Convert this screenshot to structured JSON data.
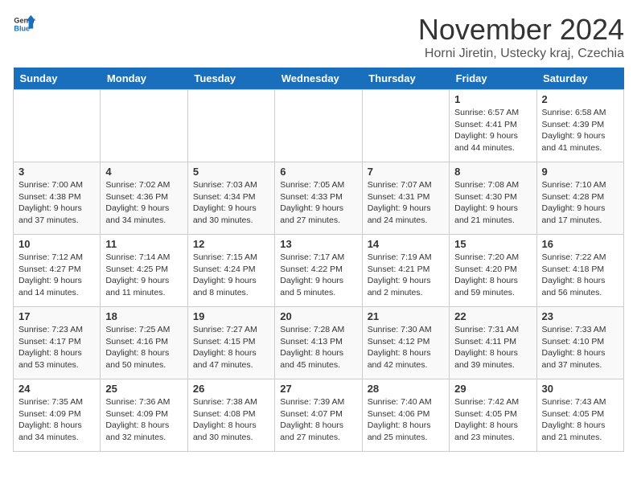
{
  "header": {
    "logo_general": "General",
    "logo_blue": "Blue",
    "title": "November 2024",
    "subtitle": "Horni Jiretin, Ustecky kraj, Czechia"
  },
  "weekdays": [
    "Sunday",
    "Monday",
    "Tuesday",
    "Wednesday",
    "Thursday",
    "Friday",
    "Saturday"
  ],
  "weeks": [
    [
      {
        "day": "",
        "info": ""
      },
      {
        "day": "",
        "info": ""
      },
      {
        "day": "",
        "info": ""
      },
      {
        "day": "",
        "info": ""
      },
      {
        "day": "",
        "info": ""
      },
      {
        "day": "1",
        "info": "Sunrise: 6:57 AM\nSunset: 4:41 PM\nDaylight: 9 hours and 44 minutes."
      },
      {
        "day": "2",
        "info": "Sunrise: 6:58 AM\nSunset: 4:39 PM\nDaylight: 9 hours and 41 minutes."
      }
    ],
    [
      {
        "day": "3",
        "info": "Sunrise: 7:00 AM\nSunset: 4:38 PM\nDaylight: 9 hours and 37 minutes."
      },
      {
        "day": "4",
        "info": "Sunrise: 7:02 AM\nSunset: 4:36 PM\nDaylight: 9 hours and 34 minutes."
      },
      {
        "day": "5",
        "info": "Sunrise: 7:03 AM\nSunset: 4:34 PM\nDaylight: 9 hours and 30 minutes."
      },
      {
        "day": "6",
        "info": "Sunrise: 7:05 AM\nSunset: 4:33 PM\nDaylight: 9 hours and 27 minutes."
      },
      {
        "day": "7",
        "info": "Sunrise: 7:07 AM\nSunset: 4:31 PM\nDaylight: 9 hours and 24 minutes."
      },
      {
        "day": "8",
        "info": "Sunrise: 7:08 AM\nSunset: 4:30 PM\nDaylight: 9 hours and 21 minutes."
      },
      {
        "day": "9",
        "info": "Sunrise: 7:10 AM\nSunset: 4:28 PM\nDaylight: 9 hours and 17 minutes."
      }
    ],
    [
      {
        "day": "10",
        "info": "Sunrise: 7:12 AM\nSunset: 4:27 PM\nDaylight: 9 hours and 14 minutes."
      },
      {
        "day": "11",
        "info": "Sunrise: 7:14 AM\nSunset: 4:25 PM\nDaylight: 9 hours and 11 minutes."
      },
      {
        "day": "12",
        "info": "Sunrise: 7:15 AM\nSunset: 4:24 PM\nDaylight: 9 hours and 8 minutes."
      },
      {
        "day": "13",
        "info": "Sunrise: 7:17 AM\nSunset: 4:22 PM\nDaylight: 9 hours and 5 minutes."
      },
      {
        "day": "14",
        "info": "Sunrise: 7:19 AM\nSunset: 4:21 PM\nDaylight: 9 hours and 2 minutes."
      },
      {
        "day": "15",
        "info": "Sunrise: 7:20 AM\nSunset: 4:20 PM\nDaylight: 8 hours and 59 minutes."
      },
      {
        "day": "16",
        "info": "Sunrise: 7:22 AM\nSunset: 4:18 PM\nDaylight: 8 hours and 56 minutes."
      }
    ],
    [
      {
        "day": "17",
        "info": "Sunrise: 7:23 AM\nSunset: 4:17 PM\nDaylight: 8 hours and 53 minutes."
      },
      {
        "day": "18",
        "info": "Sunrise: 7:25 AM\nSunset: 4:16 PM\nDaylight: 8 hours and 50 minutes."
      },
      {
        "day": "19",
        "info": "Sunrise: 7:27 AM\nSunset: 4:15 PM\nDaylight: 8 hours and 47 minutes."
      },
      {
        "day": "20",
        "info": "Sunrise: 7:28 AM\nSunset: 4:13 PM\nDaylight: 8 hours and 45 minutes."
      },
      {
        "day": "21",
        "info": "Sunrise: 7:30 AM\nSunset: 4:12 PM\nDaylight: 8 hours and 42 minutes."
      },
      {
        "day": "22",
        "info": "Sunrise: 7:31 AM\nSunset: 4:11 PM\nDaylight: 8 hours and 39 minutes."
      },
      {
        "day": "23",
        "info": "Sunrise: 7:33 AM\nSunset: 4:10 PM\nDaylight: 8 hours and 37 minutes."
      }
    ],
    [
      {
        "day": "24",
        "info": "Sunrise: 7:35 AM\nSunset: 4:09 PM\nDaylight: 8 hours and 34 minutes."
      },
      {
        "day": "25",
        "info": "Sunrise: 7:36 AM\nSunset: 4:09 PM\nDaylight: 8 hours and 32 minutes."
      },
      {
        "day": "26",
        "info": "Sunrise: 7:38 AM\nSunset: 4:08 PM\nDaylight: 8 hours and 30 minutes."
      },
      {
        "day": "27",
        "info": "Sunrise: 7:39 AM\nSunset: 4:07 PM\nDaylight: 8 hours and 27 minutes."
      },
      {
        "day": "28",
        "info": "Sunrise: 7:40 AM\nSunset: 4:06 PM\nDaylight: 8 hours and 25 minutes."
      },
      {
        "day": "29",
        "info": "Sunrise: 7:42 AM\nSunset: 4:05 PM\nDaylight: 8 hours and 23 minutes."
      },
      {
        "day": "30",
        "info": "Sunrise: 7:43 AM\nSunset: 4:05 PM\nDaylight: 8 hours and 21 minutes."
      }
    ]
  ]
}
